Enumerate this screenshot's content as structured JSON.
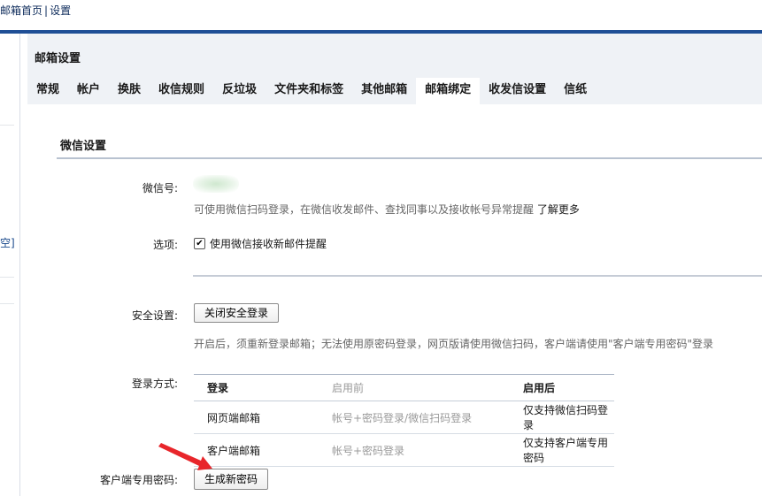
{
  "topbar": {
    "home_link": "邮箱首页",
    "separator": "|",
    "settings_link": "设置"
  },
  "left_fragment": "空]",
  "page_title": "邮箱设置",
  "tabs": [
    {
      "label": "常规",
      "active": false
    },
    {
      "label": "帐户",
      "active": false
    },
    {
      "label": "换肤",
      "active": false
    },
    {
      "label": "收信规则",
      "active": false
    },
    {
      "label": "反垃圾",
      "active": false
    },
    {
      "label": "文件夹和标签",
      "active": false
    },
    {
      "label": "其他邮箱",
      "active": false
    },
    {
      "label": "邮箱绑定",
      "active": true
    },
    {
      "label": "收发信设置",
      "active": false
    },
    {
      "label": "信纸",
      "active": false
    }
  ],
  "wechat": {
    "section_title": "微信设置",
    "account_label": "微信号:",
    "account_hint": "可使用微信扫码登录，在微信收发邮件、查找同事以及接收帐号异常提醒",
    "learn_more": "了解更多",
    "option_label": "选项:",
    "option_checkbox": "使用微信接收新邮件提醒",
    "option_checked": true
  },
  "security": {
    "label": "安全设置:",
    "button": "关闭安全登录",
    "hint": "开启后，须重新登录邮箱；无法使用原密码登录，网页版请使用微信扫码，客户端请使用\"客户端专用密码\"登录"
  },
  "login_methods": {
    "label": "登录方式:",
    "headers": [
      "登录",
      "启用前",
      "启用后"
    ],
    "rows": [
      [
        "网页端邮箱",
        "帐号+密码登录/微信扫码登录",
        "仅支持微信扫码登录"
      ],
      [
        "客户端邮箱",
        "帐号+密码登录",
        "仅支持客户端专用密码"
      ]
    ]
  },
  "client_password": {
    "label": "客户端专用密码:",
    "button": "生成新密码"
  },
  "colors": {
    "header_blue": "#1f4f96",
    "panel_bg": "#eff2f6",
    "arrow_red": "#e8262b"
  }
}
